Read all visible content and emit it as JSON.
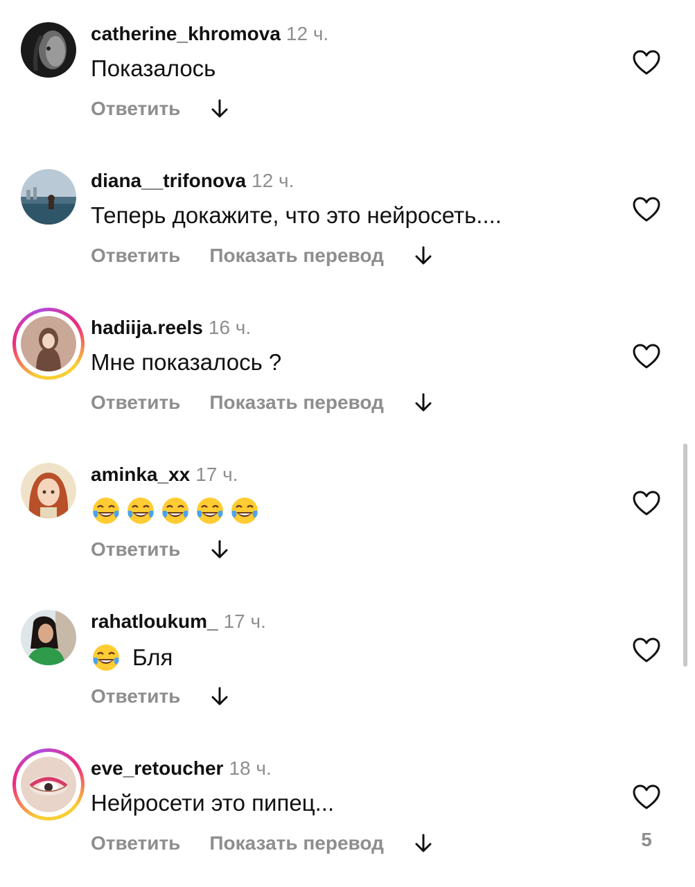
{
  "comments": [
    {
      "username": "catherine_khromova",
      "time": "12 ч.",
      "text": "Показалось",
      "emojis": [],
      "reply_label": "Ответить",
      "translate_label": null,
      "avatar": "woman-profile-dark",
      "ring": false
    },
    {
      "username": "diana__trifonova",
      "time": "12 ч.",
      "text": "Теперь докажите, что это нейросеть....",
      "emojis": [],
      "reply_label": "Ответить",
      "translate_label": "Показать перевод",
      "avatar": "infinity-pool",
      "ring": false
    },
    {
      "username": "hadiija.reels",
      "time": "16 ч.",
      "text": "Мне показалось ?",
      "emojis": [],
      "reply_label": "Ответить",
      "translate_label": "Показать перевод",
      "avatar": "hijab-illustration",
      "ring": true
    },
    {
      "username": "aminka_xx",
      "time": "17 ч.",
      "text": "",
      "emojis": [
        "face-with-tears-of-joy",
        "face-with-tears-of-joy",
        "face-with-tears-of-joy",
        "face-with-tears-of-joy",
        "face-with-tears-of-joy"
      ],
      "reply_label": "Ответить",
      "translate_label": null,
      "avatar": "redhead-cartoon",
      "ring": false
    },
    {
      "username": "rahatloukum_",
      "time": "17 ч.",
      "text": "Бля",
      "emojis": [
        "face-with-tears-of-joy"
      ],
      "reply_label": "Ответить",
      "translate_label": null,
      "avatar": "woman-green-top",
      "ring": false
    },
    {
      "username": "eve_retoucher",
      "time": "18 ч.",
      "text": "Нейросети это пипец...",
      "emojis": [],
      "reply_label": "Ответить",
      "translate_label": "Показать перевод",
      "avatar": "eye-makeup-closeup",
      "ring": true
    }
  ],
  "last_comment_like_count": "5",
  "icons": {
    "like": "heart-outline-icon",
    "expand": "arrow-down-icon"
  },
  "colors": {
    "text": "#111111",
    "muted": "#8e8e8e",
    "story_ring": [
      "#f9ce34",
      "#ee2a7b",
      "#b04ce0"
    ]
  }
}
